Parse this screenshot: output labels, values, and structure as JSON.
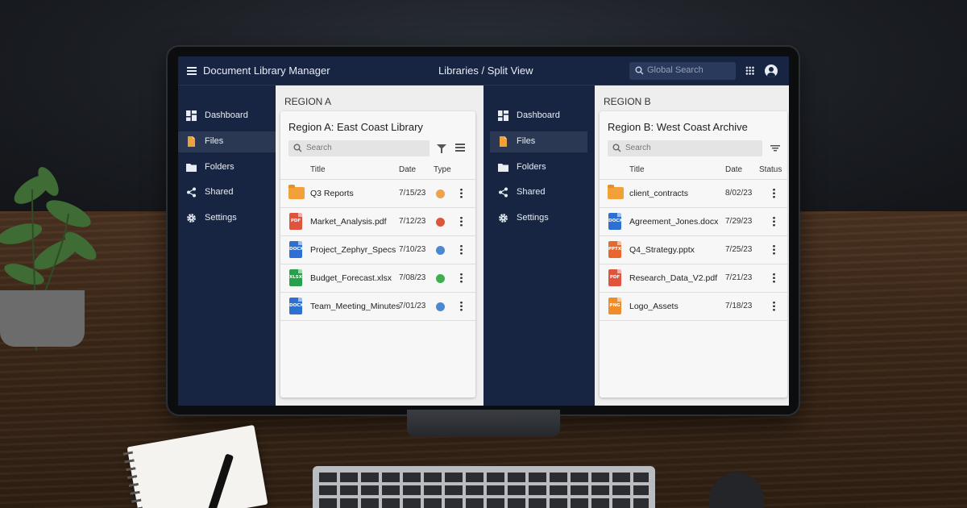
{
  "topbar": {
    "app_title": "Document Library Manager",
    "view_title": "Libraries / Split View",
    "search_placeholder": "Global Search"
  },
  "nav": [
    "Dashboard",
    "Files",
    "Folders",
    "Shared",
    "Settings"
  ],
  "active_nav": "Files",
  "regions": [
    {
      "label": "REGION A",
      "title": "Region A: East Coast Library",
      "search_placeholder": "Search",
      "columns": [
        "Title",
        "Date",
        "Type"
      ],
      "rows": [
        {
          "name": "Q3 Reports",
          "date": "7/15/23",
          "icon": "folder-icon",
          "type_color": "#f0a24a"
        },
        {
          "name": "Market_Analysis.pdf",
          "date": "7/12/23",
          "icon": "pdf-icon",
          "badge": "PDF",
          "badge_color": "#e0533c",
          "type_color": "#d9573d"
        },
        {
          "name": "Project_Zephyr_Specs",
          "date": "7/10/23",
          "icon": "docx-icon",
          "badge": "DOCX",
          "badge_color": "#2d6fd3",
          "type_color": "#4a88d6"
        },
        {
          "name": "Budget_Forecast.xlsx",
          "date": "7/08/23",
          "icon": "xlsx-icon",
          "badge": "XLSX",
          "badge_color": "#27a04a",
          "type_color": "#3fae4f"
        },
        {
          "name": "Team_Meeting_Minutes",
          "date": "7/01/23",
          "icon": "docx-icon",
          "badge": "DOCX",
          "badge_color": "#2d6fd3",
          "type_color": "#4a88d6"
        }
      ]
    },
    {
      "label": "REGION B",
      "title": "Region B: West Coast Archive",
      "search_placeholder": "Search",
      "columns": [
        "Title",
        "Date",
        "Status"
      ],
      "rows": [
        {
          "name": "client_contracts",
          "date": "8/02/23",
          "icon": "folder-icon"
        },
        {
          "name": "Agreement_Jones.docx",
          "date": "7/29/23",
          "icon": "docx-icon",
          "badge": "DOCX",
          "badge_color": "#2d6fd3"
        },
        {
          "name": "Q4_Strategy.pptx",
          "date": "7/25/23",
          "icon": "pptx-icon",
          "badge": "PPTX",
          "badge_color": "#e8672f"
        },
        {
          "name": "Research_Data_V2.pdf",
          "date": "7/21/23",
          "icon": "pdf-icon",
          "badge": "PDF",
          "badge_color": "#e0533c"
        },
        {
          "name": "Logo_Assets",
          "date": "7/18/23",
          "icon": "png-icon",
          "badge": "PNG",
          "badge_color": "#f08c2a"
        }
      ]
    }
  ]
}
